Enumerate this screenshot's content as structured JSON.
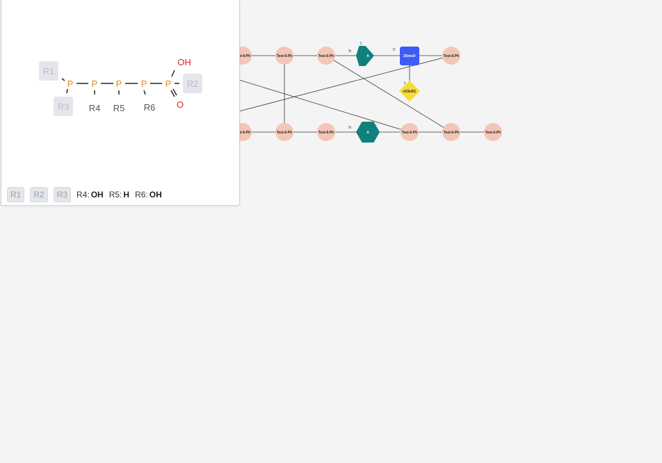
{
  "canvas": {
    "monomers": [
      {
        "id": "m1",
        "label": "Test-6-Ph",
        "type": "circle",
        "color": "#f3c6b8"
      },
      {
        "id": "m2",
        "label": "Test-6-Ph",
        "type": "circle",
        "color": "#f3c6b8"
      },
      {
        "id": "m3",
        "label": "Test-6-Ph",
        "type": "circle",
        "color": "#f3c6b8"
      },
      {
        "id": "m4",
        "label": "A",
        "type": "hexagon",
        "color": "#10807d"
      },
      {
        "id": "m5",
        "label": "25mo3r",
        "type": "square",
        "color": "#3d5cf5"
      },
      {
        "id": "m6",
        "label": "Test-6-Ph",
        "type": "circle",
        "color": "#f3c6b8"
      },
      {
        "id": "m7",
        "label": "nC6n5C",
        "type": "diamond",
        "color": "#f8d93a"
      },
      {
        "id": "m8",
        "label": "Test-6-Ph",
        "type": "circle",
        "color": "#f3c6b8"
      },
      {
        "id": "m9",
        "label": "Test-6-Ph",
        "type": "circle",
        "color": "#f3c6b8"
      },
      {
        "id": "m10",
        "label": "Test-6-Ph",
        "type": "circle",
        "color": "#f3c6b8"
      },
      {
        "id": "m11",
        "label": "A",
        "type": "hexagon",
        "color": "#10807d"
      },
      {
        "id": "m12",
        "label": "Test-6-Ph",
        "type": "circle",
        "color": "#f3c6b8"
      },
      {
        "id": "m13",
        "label": "Test-6-Ph",
        "type": "circle",
        "color": "#f3c6b8"
      },
      {
        "id": "m14",
        "label": "Test-6-Ph",
        "type": "circle",
        "color": "#f3c6b8"
      }
    ],
    "bond_labels": [
      {
        "text": "N"
      },
      {
        "text": "1"
      },
      {
        "text": "5'"
      },
      {
        "text": "1"
      },
      {
        "text": "N"
      }
    ]
  },
  "preview": {
    "atoms": {
      "p1": "P",
      "p2": "P",
      "p3": "P",
      "p4": "P",
      "p5": "P",
      "oh": "OH",
      "o": "O"
    },
    "r_labels": {
      "r4": "R4",
      "r5": "R5",
      "r6": "R6"
    },
    "r_boxes": {
      "r1": "R1",
      "r2": "R2",
      "r3": "R3"
    },
    "legend": {
      "chips": [
        "R1",
        "R2",
        "R3"
      ],
      "groups": [
        {
          "name": "R4:",
          "value": "OH"
        },
        {
          "name": "R5:",
          "value": "H"
        },
        {
          "name": "R6:",
          "value": "OH"
        }
      ]
    }
  },
  "colors": {
    "phosphorus": "#e08a1a",
    "oxygen": "#d9231d",
    "rgroup_box": "#e4e6ea"
  }
}
